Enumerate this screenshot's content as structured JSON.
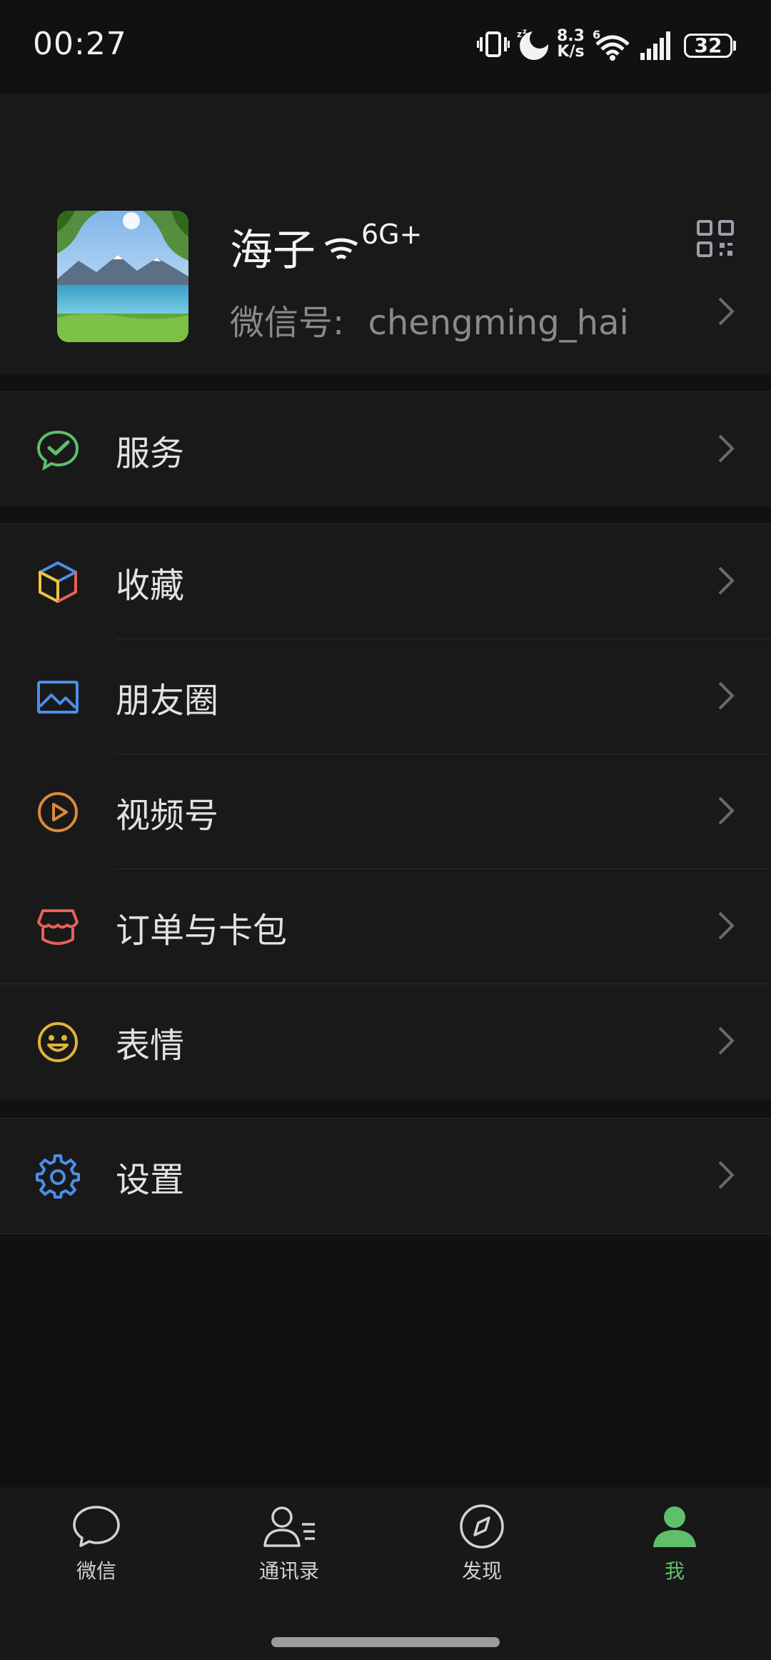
{
  "status_bar": {
    "time": "00:27",
    "net_speed_value": "8.3",
    "net_speed_unit": "K/s",
    "battery": "32",
    "icons": [
      "vibrate-icon",
      "do-not-disturb-icon",
      "wifi-6-icon",
      "cellular-signal-icon",
      "battery-icon"
    ]
  },
  "profile": {
    "nickname": "海子",
    "nickname_suffix_text": "6G+",
    "wechat_id_label": "微信号:",
    "wechat_id": "chengming_hai"
  },
  "menu": {
    "service": "服务",
    "favorites": "收藏",
    "moments": "朋友圈",
    "channels": "视频号",
    "orders_cards": "订单与卡包",
    "stickers": "表情",
    "settings": "设置"
  },
  "tabs": [
    {
      "label": "微信",
      "icon": "chat-bubble-icon",
      "active": false
    },
    {
      "label": "通讯录",
      "icon": "contacts-icon",
      "active": false
    },
    {
      "label": "发现",
      "icon": "compass-icon",
      "active": false
    },
    {
      "label": "我",
      "icon": "me-person-icon",
      "active": true
    }
  ],
  "colors": {
    "accent_green": "#5fbf6b",
    "background": "#111111",
    "surface": "#191919"
  }
}
